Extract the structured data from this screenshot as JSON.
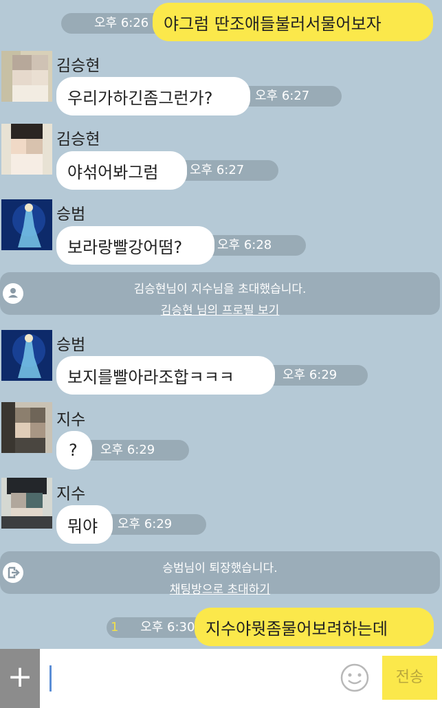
{
  "messages": [
    {
      "sender": "",
      "text": "야그럼 딴조애들불러서물어보자",
      "time": "오후 6:26"
    },
    {
      "sender": "김승현",
      "text": "우리가하긴좀그런가?",
      "time": "오후 6:27"
    },
    {
      "sender": "김승현",
      "text": "야섞어봐그럼",
      "time": "오후 6:27"
    },
    {
      "sender": "승범",
      "text": "보라랑빨강어떰?",
      "time": "오후 6:28"
    },
    {
      "sender": "승범",
      "text": "보지를빨아라조합ㅋㅋㅋ",
      "time": "오후 6:29"
    },
    {
      "sender": "지수",
      "text": "?",
      "time": "오후 6:29"
    },
    {
      "sender": "지수",
      "text": "뭐야",
      "time": "오후 6:29"
    },
    {
      "sender": "",
      "text": "지수야뭣좀물어보려하는데",
      "time": "오후 6:30",
      "unread": "1"
    }
  ],
  "system": [
    {
      "line1": "김승현님이 지수님을 초대했습니다.",
      "link": "김승현 님의 프로필 보기"
    },
    {
      "line1": "승범님이 퇴장했습니다.",
      "link": "채팅방으로 초대하기"
    }
  ],
  "input": {
    "placeholder": "",
    "send_label": "전송",
    "plus": "+"
  },
  "colors": {
    "background": "#b5c9d6",
    "my_bubble": "#fbe84b",
    "their_bubble": "#ffffff",
    "send_button": "#fbe84b"
  }
}
